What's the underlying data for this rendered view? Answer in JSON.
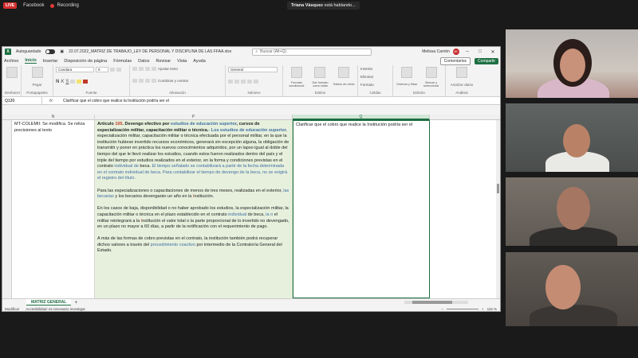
{
  "stream": {
    "live_label": "LIVE",
    "platform": "Facebook",
    "recording_label": "Recording",
    "speaking_name": "Triana Vásquez",
    "speaking_suffix": "está hablando..."
  },
  "excel": {
    "autosave_label": "Autoguardado",
    "filename": "22.07.2022_MATRIZ DE TRABAJO_LEY DE PERSONAL Y DISCIPLINA DE LAS FFAA.xlsx",
    "search_placeholder": "Buscar (Alt+Q)",
    "user_name": "Melissa Carrión",
    "user_initials": "MC",
    "menu": [
      "Archivo",
      "Inicio",
      "Insertar",
      "Disposición de página",
      "Fórmulas",
      "Datos",
      "Revisar",
      "Vista",
      "Ayuda"
    ],
    "active_menu": "Inicio",
    "comments_label": "Comentarios",
    "share_label": "Compartir",
    "ribbon": {
      "undo_label": "Deshacer",
      "clipboard_label": "Portapapeles",
      "paste_label": "Pegar",
      "font_name": "Candara",
      "font_size": "9",
      "font_label": "Fuente",
      "wrap_label": "Ajustar texto",
      "merge_label": "Combinar y centrar",
      "alignment_label": "Alineación",
      "number_format": "General",
      "number_label": "Número",
      "conditional_label": "Formato condicional",
      "table_format_label": "Dar formato como tabla",
      "cell_styles_label": "Estilos de celda",
      "styles_label": "Estilos",
      "insert_label": "Insertar",
      "delete_label": "Eliminar",
      "format_label": "Formato",
      "cells_label": "Celdas",
      "sort_label": "Ordenar y filtrar",
      "find_label": "Buscar y seleccionar",
      "editing_label": "Edición",
      "analyze_label": "Analizar datos",
      "analysis_label": "Análisis"
    },
    "name_box": "Q130",
    "formula": "Clarificar que el cobro que realice la Institución podría ser el",
    "columns": {
      "n": "N",
      "p": "P",
      "q": "Q"
    },
    "cell_n": "MT-COLEMII: Se  modifica. Se reliza precisiones al texto",
    "cell_q": "Clarificar que el cobro que realice la Institución podría ser el",
    "cell_p": {
      "article_label": "Artículo",
      "article_num": "105",
      "article_title": ". Devengo efectivo por ",
      "title_blue": "estudios de educación superior",
      "title_rest": ", cursos de especialización militar, capacitación militar o técnica.",
      "title_blue2": "- Los estudios de educación superior",
      "p1_rest": ", especialización militar,  capacitación militar o técnica efectuada por el personal militar, en la que la institución hubiese invertido recursos económicos, generará sin excepción alguna, la obligación de transmitir y poner en práctica los nuevos conocimientos adquiridos, por un lapso igual al doble del tiempo del que le llevó realizar los estudios, cuando estos fueron realizados dentro del país y el triple del tiempo por estudios realizados en el exterior, en la forma y condiciones previstas en el contrato ",
      "p1_blue": "individual de",
      "p1_end": " beca. ",
      "p1_blue_end": "El tiempo señalado se contabilizará a partir de la fecha determinada en el contrato individual de beca. Para contabilizar el tiempo de devengo de la beca, no se exigirá el registro del título.",
      "p2_start": "Para las especializaciones o capacitaciones de menos de tres meses, realizadas en el exterior, ",
      "p2_blue": "las becarias",
      "p2_end": " y los becarios devengarán un año en la ",
      "p2_red": "I",
      "p2_last": "nstitución.",
      "p3_start": "En los casos de baja, disponibilidad o no haber aprobado los estudios, la especialización militar, la capacitación militar o técnica en el plazo establecido en el contrato ",
      "p3_blue": "individual",
      "p3_mid": " de beca, ",
      "p3_blue2": "la o",
      "p3_mid2": " el militar reintegrará a la ",
      "p3_red": "I",
      "p3_end": "nstitución el valor total o la parte proporcional de lo invertido no devengado, en un plazo no mayor a 60 días, a partir de la notificación con el requerimiento de pago.",
      "p4_start": "A más de las formas de cobro previstas en el contrato, la institución también podrá recuperar dichos valores a través del ",
      "p4_blue": "procedimiento coactivo",
      "p4_end": " por intermedio de la Contraloría General del Estado."
    },
    "sheet_tab": "MATRIZ GENERAL",
    "status_mode": "Modificar",
    "accessibility": "Accesibilidad: es necesario investigar",
    "zoom": "115 %"
  },
  "colors": {
    "excel_green": "#1d6f42",
    "cell_p_bg": "#e7f0dd",
    "text_blue": "#3f6ea3",
    "live_red": "#d32f2f"
  }
}
